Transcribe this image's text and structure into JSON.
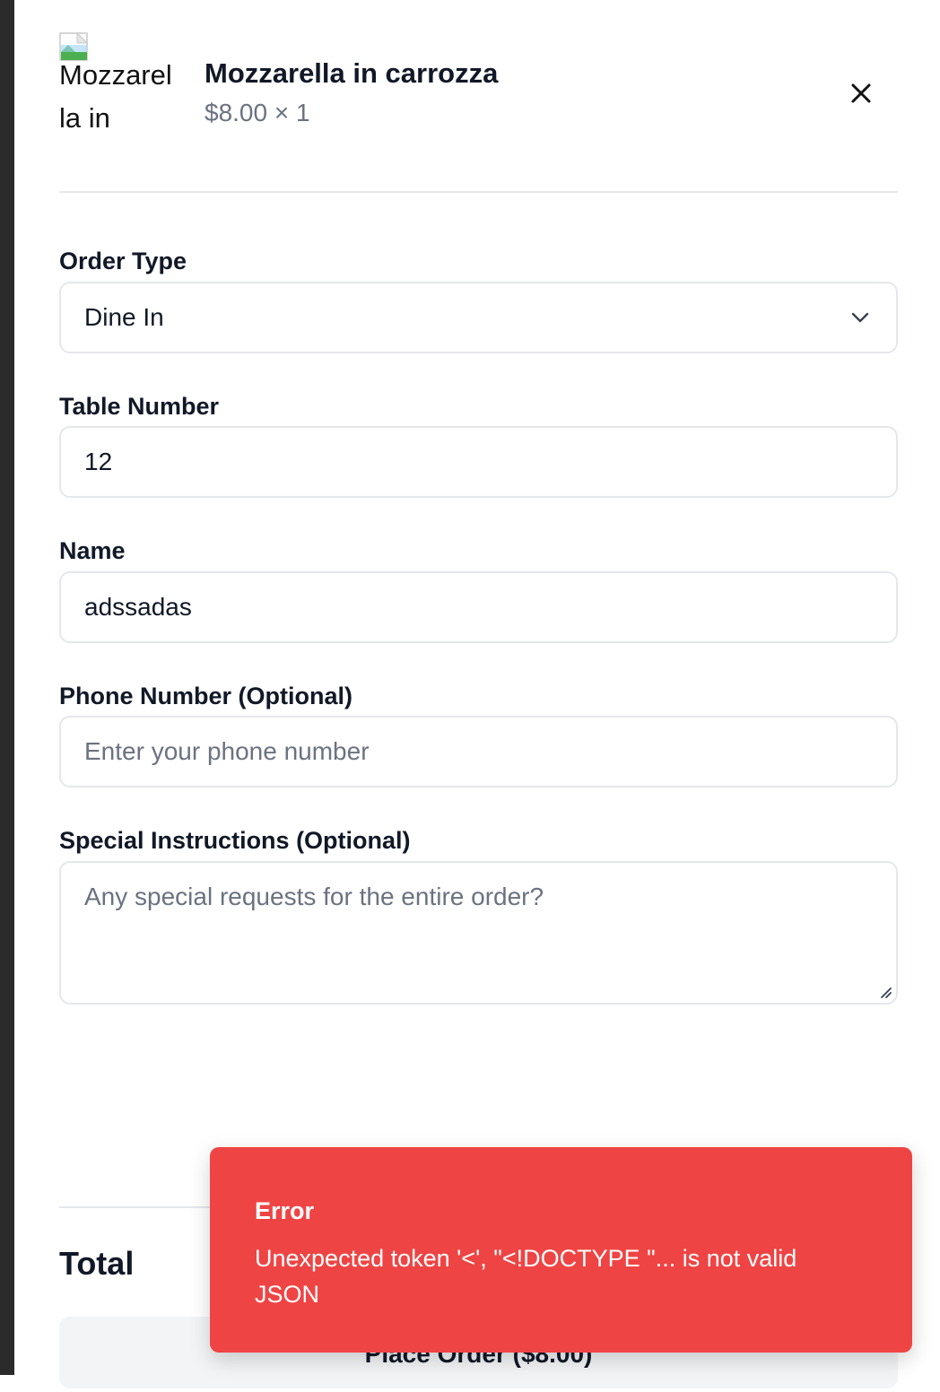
{
  "cart": {
    "item": {
      "image_alt": "Mozzarella in",
      "name": "Mozzarella in carrozza",
      "price_qty": "$8.00 × 1",
      "remove_icon": "close-icon"
    }
  },
  "form": {
    "order_type": {
      "label": "Order Type",
      "selected": "Dine In",
      "icon": "chevron-down-icon"
    },
    "table_number": {
      "label": "Table Number",
      "value": "12"
    },
    "name": {
      "label": "Name",
      "value": "adssadas"
    },
    "phone": {
      "label": "Phone Number (Optional)",
      "placeholder": "Enter your phone number"
    },
    "instructions": {
      "label": "Special Instructions (Optional)",
      "placeholder": "Any special requests for the entire order?"
    }
  },
  "summary": {
    "total_label": "Total",
    "place_order_label": "Place Order ($8.00)"
  },
  "toast": {
    "title": "Error",
    "message": "Unexpected token '<', \"<!DOCTYPE \"... is not valid JSON",
    "color": "#ef4444"
  }
}
